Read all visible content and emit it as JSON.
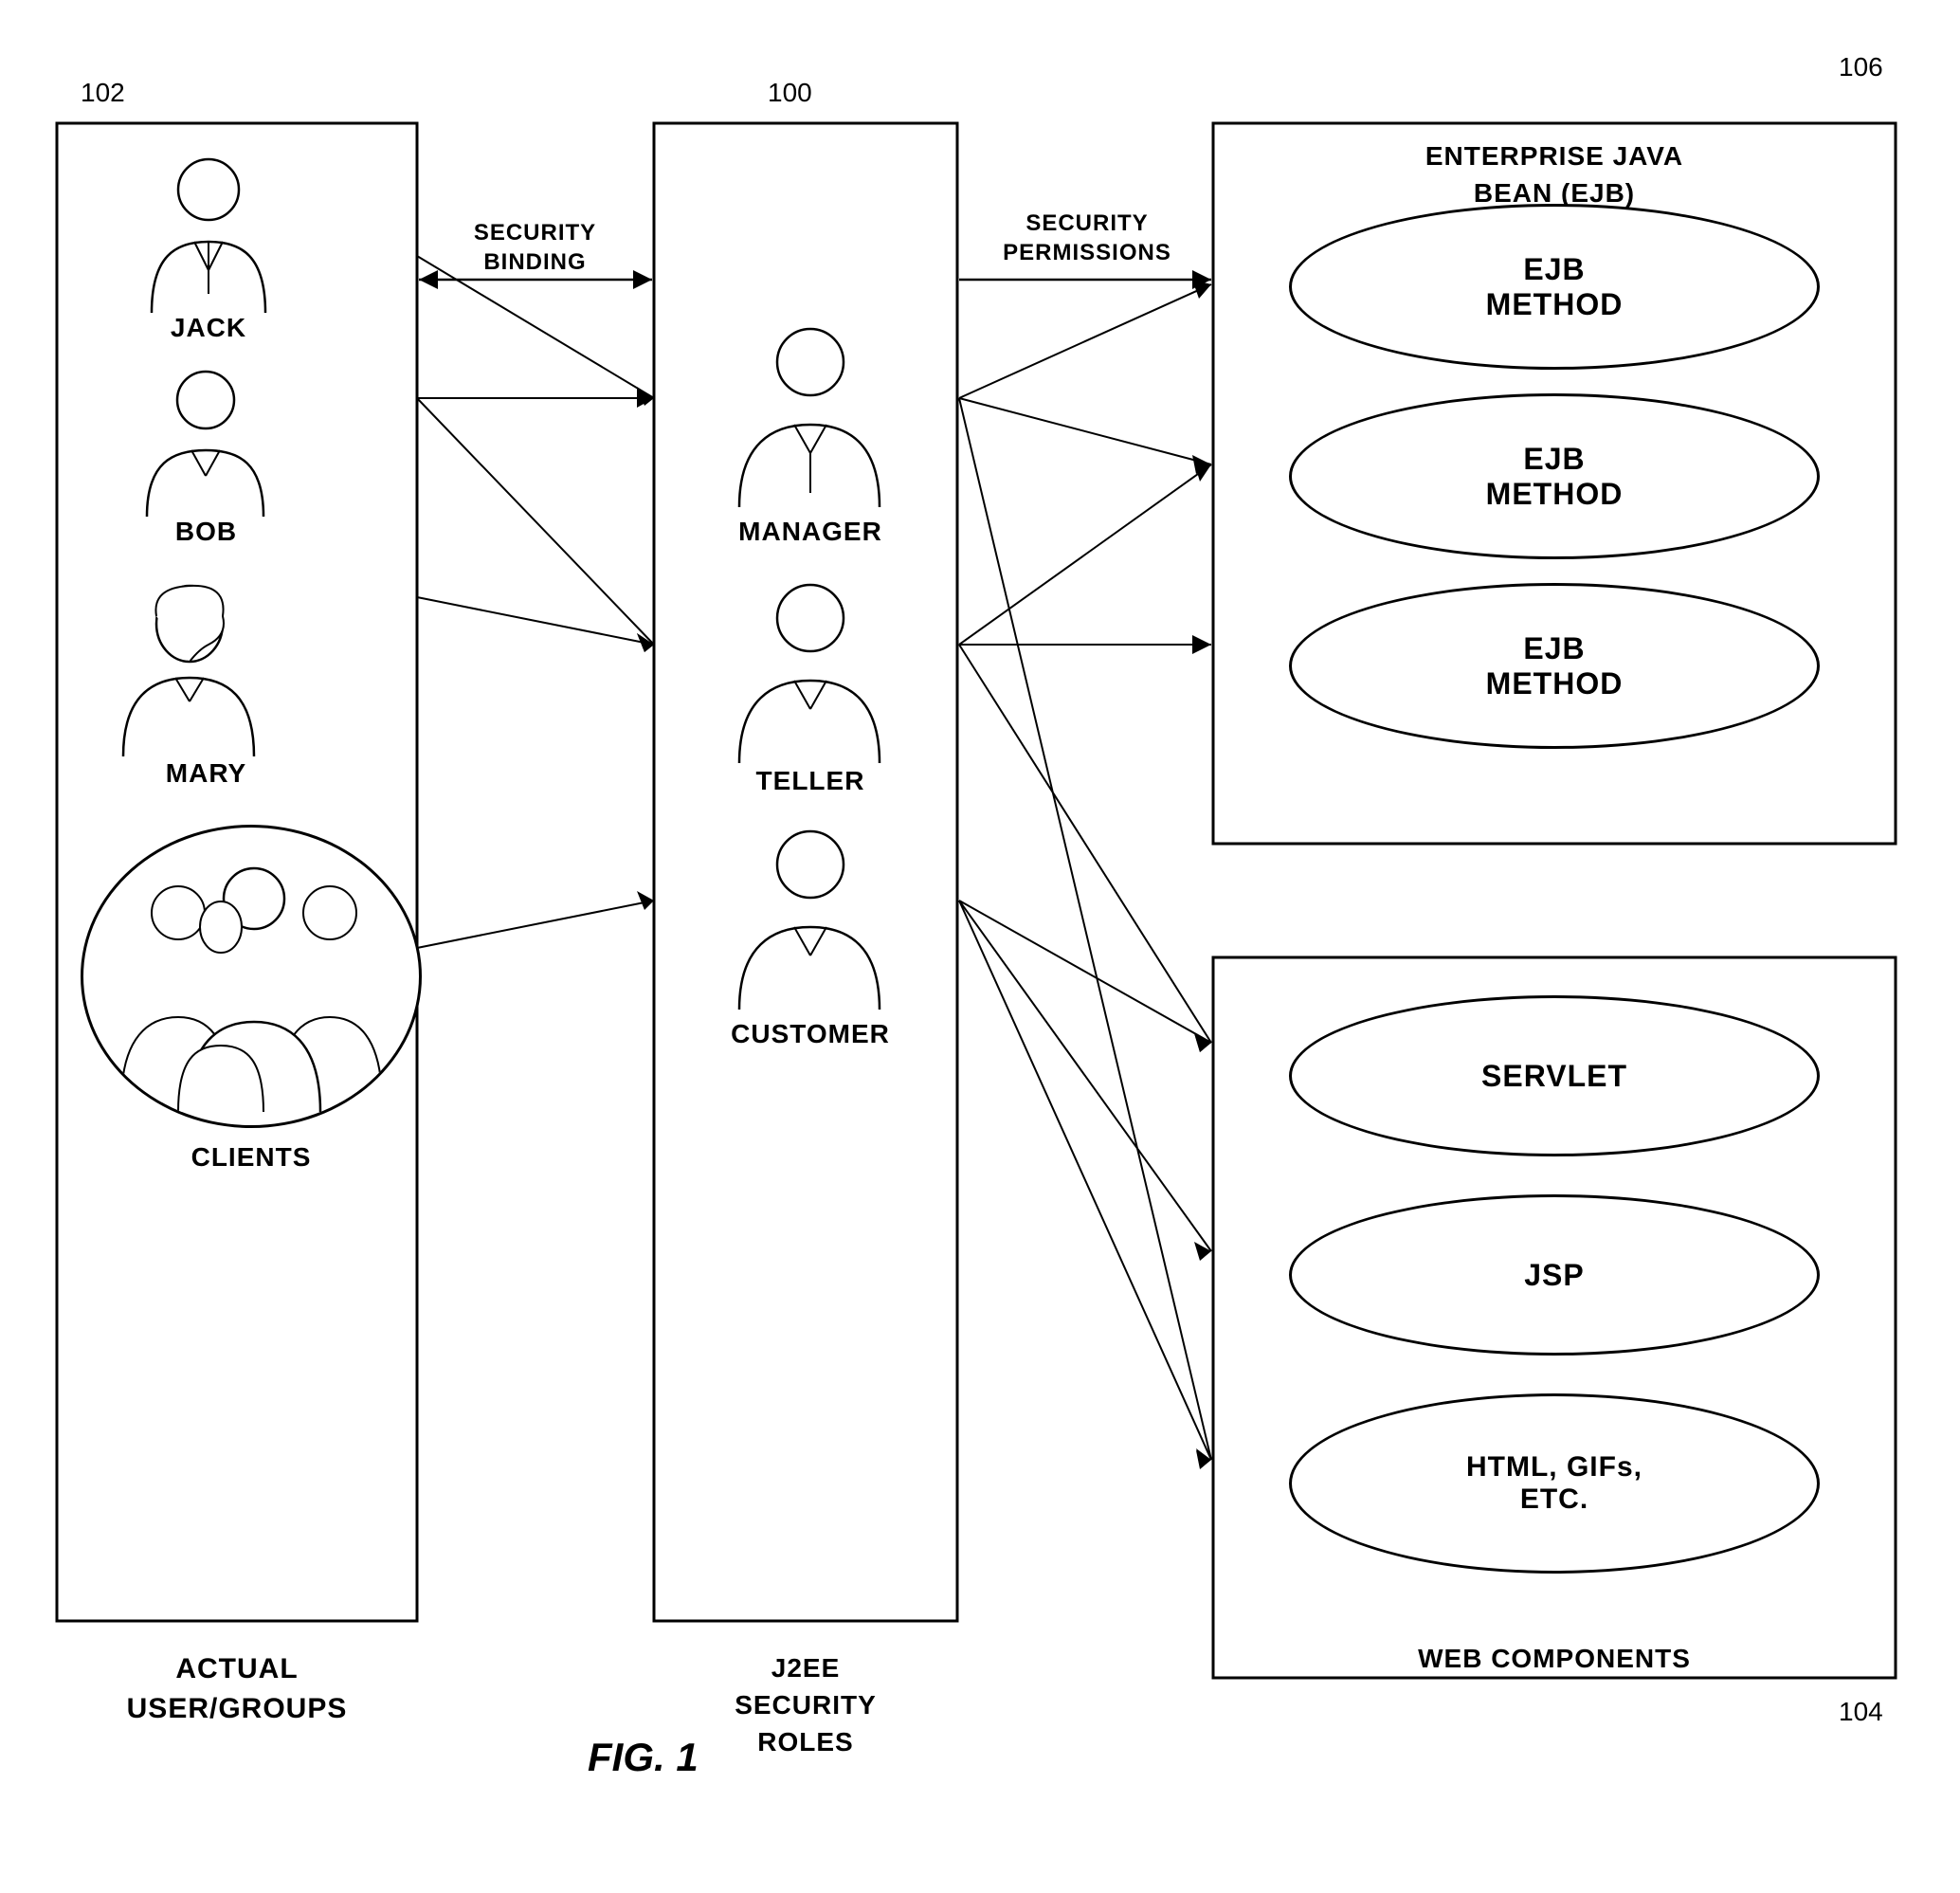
{
  "ref102": "102",
  "ref100": "100",
  "ref106": "106",
  "ref104": "104",
  "leftBox": {
    "title": "ACTUAL\nUSER/GROUPS"
  },
  "middleBox": {
    "title": "J2EE\nSECURITY\nROLES"
  },
  "ejbBox": {
    "title": "ENTERPRISE JAVA\nBEAN (EJB)"
  },
  "webBox": {
    "title": "WEB COMPONENTS"
  },
  "persons": [
    {
      "name": "JACK"
    },
    {
      "name": "BOB"
    },
    {
      "name": "MARY"
    },
    {
      "name": "CLIENTS"
    }
  ],
  "roles": [
    {
      "name": "MANAGER"
    },
    {
      "name": "TELLER"
    },
    {
      "name": "CUSTOMER"
    }
  ],
  "ejbMethods": [
    {
      "label": "EJB\nMETHOD"
    },
    {
      "label": "EJB\nMETHOD"
    },
    {
      "label": "EJB\nMETHOD"
    }
  ],
  "webComponents": [
    {
      "label": "SERVLET"
    },
    {
      "label": "JSP"
    },
    {
      "label": "HTML, GIFs,\nETC."
    }
  ],
  "arrows": {
    "securityBinding": "SECURITY\nBINDING",
    "securityPermissions": "SECURITY\nPERMISSIONS"
  },
  "figCaption": "FIG. 1"
}
